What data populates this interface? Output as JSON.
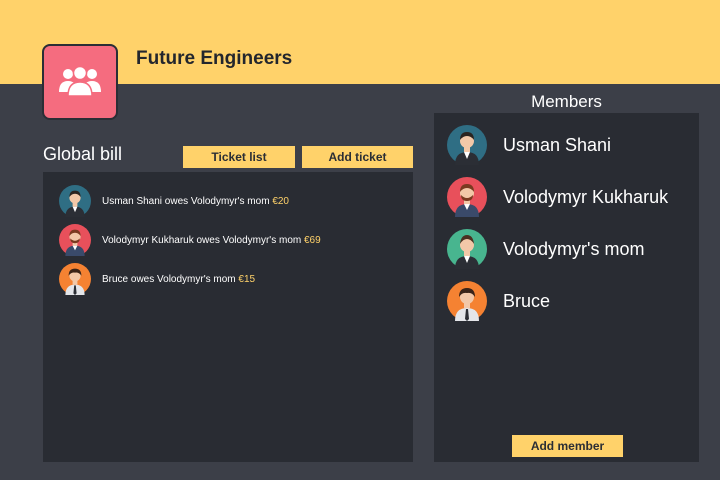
{
  "group": {
    "title": "Future Engineers",
    "logo_icon": "group-icon",
    "logo_color": "#f56c7f"
  },
  "global_bill": {
    "title": "Global bill",
    "ticket_list_label": "Ticket list",
    "add_ticket_label": "Add ticket",
    "entries": [
      {
        "text": "Usman Shani owes Volodymyr's mom",
        "amount": "€20",
        "avatar_color": "#2f6e84"
      },
      {
        "text": "Volodymyr Kukharuk owes Volodymyr's mom",
        "amount": "€69",
        "avatar_color": "#e8505b"
      },
      {
        "text": "Bruce owes Volodymyr's mom",
        "amount": "€15",
        "avatar_color": "#f58232"
      }
    ]
  },
  "members": {
    "title": "Members",
    "add_member_label": "Add member",
    "items": [
      {
        "name": "Usman Shani",
        "avatar_color": "#2f6e84"
      },
      {
        "name": "Volodymyr Kukharuk",
        "avatar_color": "#e8505b"
      },
      {
        "name": "Volodymyr's mom",
        "avatar_color": "#48b58f"
      },
      {
        "name": "Bruce",
        "avatar_color": "#f58232"
      }
    ]
  },
  "colors": {
    "accent": "#ffd26a",
    "background": "#3c3f48",
    "panel": "#292c33"
  }
}
